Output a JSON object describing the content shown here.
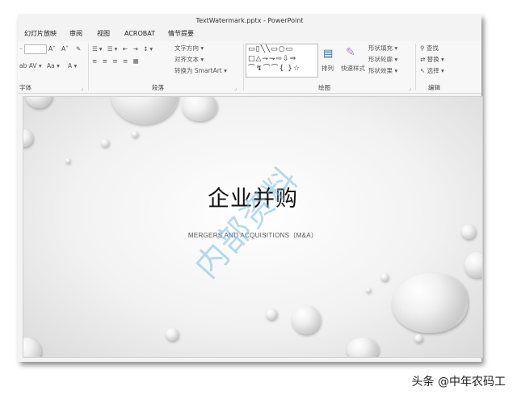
{
  "window": {
    "title": "TextWatermark.pptx - PowerPoint"
  },
  "tabs": [
    "幻灯片放映",
    "审阅",
    "视图",
    "ACROBAT",
    "情节提要"
  ],
  "ribbon": {
    "font_group": {
      "label": "字体",
      "ctrl_a_up": "A˄",
      "ctrl_a_down": "A˅",
      "ctrl_aa": "Aa ▾",
      "ctrl_av": "AV ▾"
    },
    "paragraph_group": {
      "label": "段落",
      "text_direction": "文字方向 ▾",
      "align_text": "对齐文本 ▾",
      "smartart": "转换为 SmartArt ▾"
    },
    "drawing_group": {
      "label": "绘图",
      "arrange": "排列",
      "quick_styles": "快速样式",
      "shape_fill": "形状填充 ▾",
      "shape_outline": "形状轮廓 ▾",
      "shape_effects": "形状效果 ▾"
    },
    "editing_group": {
      "label": "编辑",
      "find": "查找",
      "replace": "替换 ▾",
      "select": "选择 ▾"
    }
  },
  "slide": {
    "title": "企业并购",
    "subtitle": "MERGERS AND ACQUISITIONS（M&A）",
    "watermark": "内部资料"
  },
  "credit": "头条 @中年农码工"
}
